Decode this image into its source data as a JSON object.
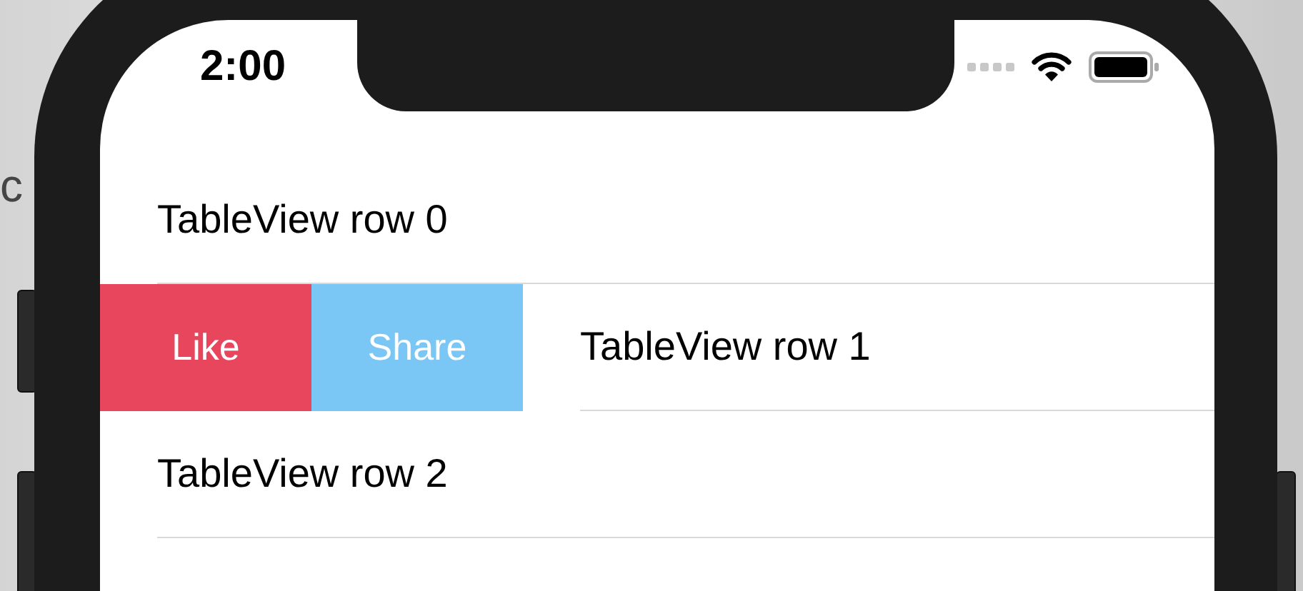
{
  "background_text": "c",
  "status_bar": {
    "time": "2:00"
  },
  "rows": [
    {
      "label": "TableView row 0"
    },
    {
      "label": "TableView row 1",
      "swiped": true,
      "actions": [
        {
          "label": "Like",
          "color": "#e8465d"
        },
        {
          "label": "Share",
          "color": "#7ac6f5"
        }
      ]
    },
    {
      "label": "TableView row 2"
    }
  ]
}
